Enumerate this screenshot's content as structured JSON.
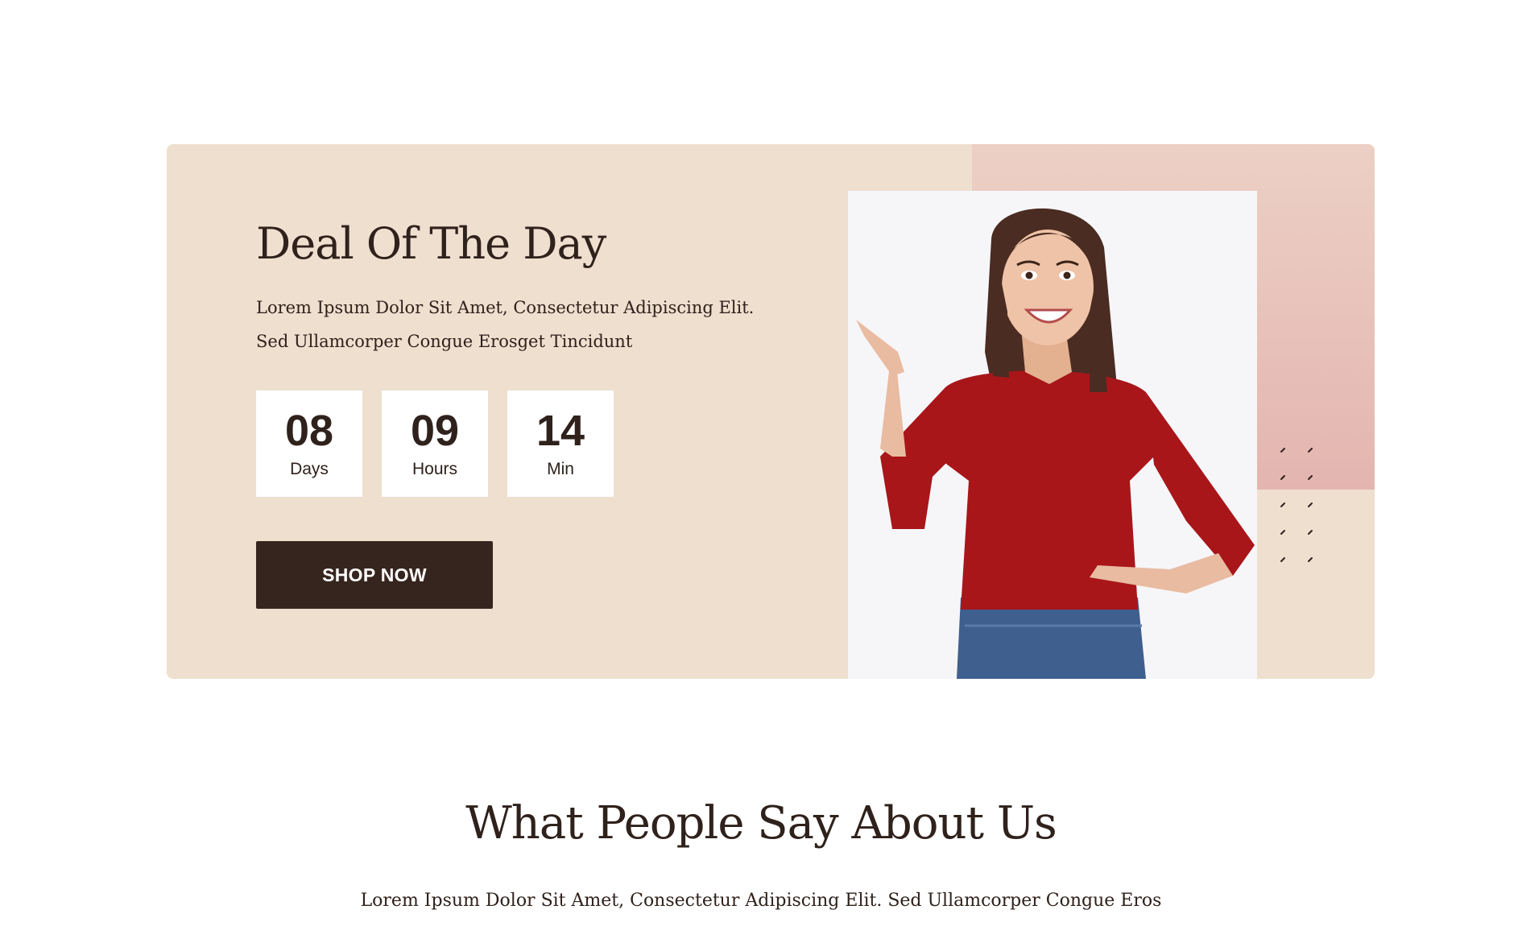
{
  "deal": {
    "title": "Deal Of The Day",
    "description": "Lorem Ipsum Dolor Sit Amet, Consectetur Adipiscing Elit. Sed Ullamcorper Congue Erosget Tincidunt",
    "countdown": [
      {
        "value": "08",
        "label": "Days"
      },
      {
        "value": "09",
        "label": "Hours"
      },
      {
        "value": "14",
        "label": "Min"
      }
    ],
    "button_label": "SHOP NOW",
    "image": "smiling-woman-pointing-up-photo"
  },
  "testimonials": {
    "title": "What People Say About Us",
    "subtitle": "Lorem Ipsum Dolor Sit Amet, Consectetur Adipiscing Elit. Sed Ullamcorper Congue Eros"
  },
  "colors": {
    "banner_bg": "#eedfcf",
    "accent_pink": "#e4b5b0",
    "dark_brown": "#36251e",
    "text": "#2f211b",
    "shirt_red": "#a8161a"
  }
}
